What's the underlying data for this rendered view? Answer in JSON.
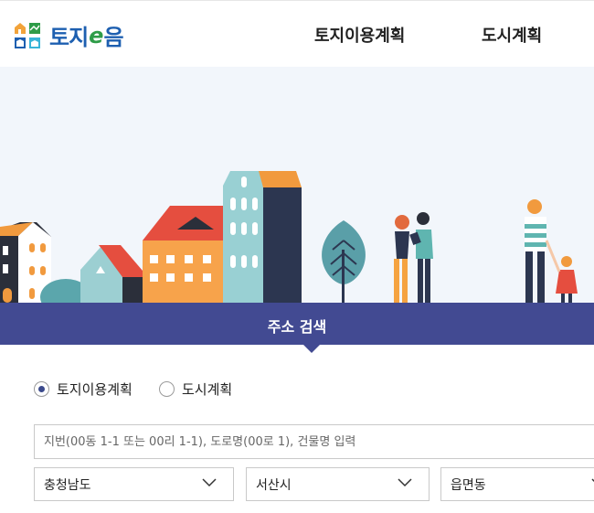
{
  "header": {
    "logo_text_1": "토지",
    "logo_text_e": "e",
    "logo_text_2": "음",
    "nav": [
      "토지이용계획",
      "도시계획"
    ]
  },
  "search": {
    "title": "주소 검색",
    "radio_options": [
      "토지이용계획",
      "도시계획"
    ],
    "selected_radio": "토지이용계획",
    "input_placeholder": "지번(00동 1-1 또는 00리 1-1), 도로명(00로 1), 건물명 입력",
    "input_value": "",
    "selects": [
      "충청남도",
      "서산시",
      "읍면동"
    ]
  },
  "colors": {
    "brand_blue": "#1d5fb0",
    "brand_green": "#2e9c48",
    "search_bar": "#424a92"
  }
}
